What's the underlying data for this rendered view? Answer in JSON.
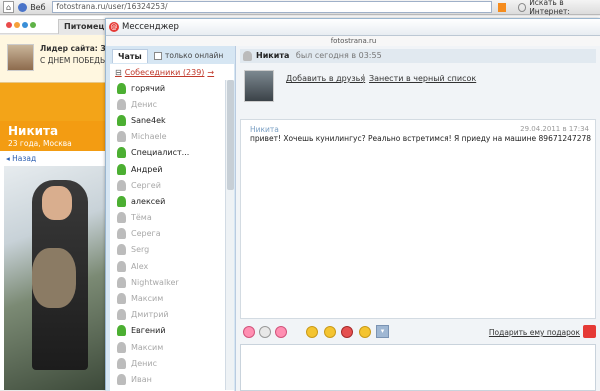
{
  "browser": {
    "web_label": "Веб",
    "url": "fotostrana.ru/user/16324253/",
    "search_label": "Искать в Интернет:"
  },
  "site": {
    "tab_label": "Питомец",
    "leader_title": "Лидер сайта: З",
    "leader_message": "С ДНЕМ ПОБЕДЫ!",
    "profile_name": "Никита",
    "profile_age": "23 года, Москва",
    "back_label": "Назад"
  },
  "messenger": {
    "title": "Мессенджер",
    "domain": "fotostrana.ru",
    "tab_chats": "Чаты",
    "tab_online": "только онлайн",
    "group_label": "Собеседники (239)",
    "contacts": [
      {
        "name": "горячий",
        "online": true
      },
      {
        "name": "Денис",
        "online": false
      },
      {
        "name": "Sane4ek",
        "online": true
      },
      {
        "name": "Michaele",
        "online": false
      },
      {
        "name": "Специалист...",
        "online": true
      },
      {
        "name": "Андрей",
        "online": true
      },
      {
        "name": "Сергей",
        "online": false
      },
      {
        "name": "алексей",
        "online": true
      },
      {
        "name": "Тёма",
        "online": false
      },
      {
        "name": "Серега",
        "online": false
      },
      {
        "name": "Serg",
        "online": false
      },
      {
        "name": "Alex",
        "online": false
      },
      {
        "name": "Nightwalker",
        "online": false
      },
      {
        "name": "Максим",
        "online": false
      },
      {
        "name": "Дмитрий",
        "online": false
      },
      {
        "name": "Евгений",
        "online": true
      },
      {
        "name": "Максим",
        "online": false
      },
      {
        "name": "Денис",
        "online": false
      },
      {
        "name": "Иван",
        "online": false
      }
    ],
    "chat": {
      "name": "Никита",
      "last_seen": "был сегодня в 03:55",
      "add_friend": "Добавить в друзья",
      "blacklist": "Занести в черный список",
      "message_author": "Никита",
      "message_date": "29.04.2011 в 17:34",
      "message_text": "привет! Хочешь кунилингус? Реально встретимся! Я приеду на машине 89671247278",
      "gift_label": "Подарить ему подарок"
    }
  },
  "colors": {
    "orange": "#f39c12",
    "online": "#4caf32",
    "offline": "#bcbcbc",
    "link_red": "#c0392b"
  }
}
